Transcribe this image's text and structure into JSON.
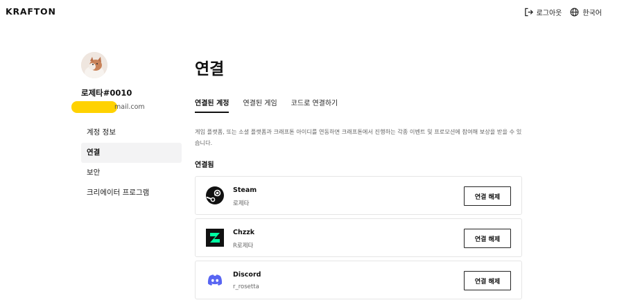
{
  "header": {
    "logo": "KRAFTON",
    "logout_label": "로그아웃",
    "language_label": "한국어"
  },
  "profile": {
    "username": "로제타#0010",
    "email_visible": "mail.com"
  },
  "sidebar": {
    "items": [
      {
        "label": "계정 정보",
        "active": false
      },
      {
        "label": "연결",
        "active": true
      },
      {
        "label": "보안",
        "active": false
      },
      {
        "label": "크리에이터 프로그램",
        "active": false
      }
    ]
  },
  "main": {
    "title": "연결",
    "tabs": [
      {
        "label": "연결된 계정",
        "active": true
      },
      {
        "label": "연결된 게임",
        "active": false
      },
      {
        "label": "코드로 연결하기",
        "active": false
      }
    ],
    "description": "게임 플랫폼, 또는 소셜 플랫폼과 크래프톤 아이디를 연동하면 크래프톤에서 진행하는 각종 이벤트 및 프로모션에 참여해 보상을 받을 수 있습니다.",
    "section_label": "연결됨",
    "accounts": [
      {
        "platform": "Steam",
        "username": "로제타",
        "icon": "steam-icon",
        "button_label": "연결 해제"
      },
      {
        "platform": "Chzzk",
        "username": "R로제타",
        "icon": "chzzk-icon",
        "button_label": "연결 해제"
      },
      {
        "platform": "Discord",
        "username": "r_rosetta",
        "icon": "discord-icon",
        "button_label": "연결 해제"
      }
    ]
  },
  "colors": {
    "chzzk_bg": "#111111",
    "chzzk_accent": "#00ffa3",
    "discord": "#5865f2",
    "active_nav_bg": "#f3f3f4",
    "redaction": "#ffd200"
  }
}
